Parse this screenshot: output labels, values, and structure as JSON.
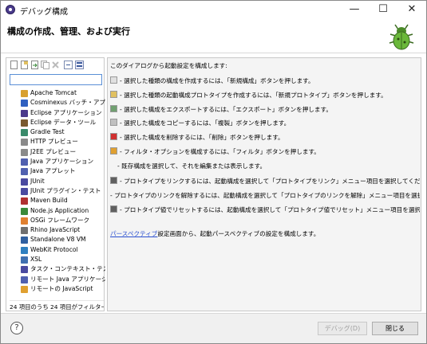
{
  "window": {
    "title": "デバッグ構成",
    "minimize_glyph": "—",
    "maximize_glyph": "☐",
    "close_glyph": "✕"
  },
  "header": {
    "title": "構成の作成、管理、および実行"
  },
  "left": {
    "filter_placeholder": "",
    "items": [
      {
        "label": "Apache Tomcat",
        "icon": "tomcat-icon",
        "color": "#d8a030"
      },
      {
        "label": "Cosminexus バッチ・アプリケ",
        "icon": "cosminexus-icon",
        "color": "#3060c0"
      },
      {
        "label": "Eclipse アプリケーション",
        "icon": "eclipse-icon",
        "color": "#4b3a8c"
      },
      {
        "label": "Eclipse データ・ツール",
        "icon": "datatools-icon",
        "color": "#7a5a30"
      },
      {
        "label": "Gradle Test",
        "icon": "gradle-icon",
        "color": "#3a8a6a"
      },
      {
        "label": "HTTP プレビュー",
        "icon": "http-icon",
        "color": "#8a8a8a"
      },
      {
        "label": "J2EE プレビュー",
        "icon": "j2ee-icon",
        "color": "#8a8a8a"
      },
      {
        "label": "Java アプリケーション",
        "icon": "java-app-icon",
        "color": "#5060b0"
      },
      {
        "label": "Java アプレット",
        "icon": "java-applet-icon",
        "color": "#5060b0"
      },
      {
        "label": "JUnit",
        "icon": "junit-icon",
        "color": "#4a4aa0"
      },
      {
        "label": "JUnit プラグイン・テスト",
        "icon": "junit-plugin-icon",
        "color": "#4a4aa0"
      },
      {
        "label": "Maven Build",
        "icon": "maven-icon",
        "color": "#b03030"
      },
      {
        "label": "Node.js Application",
        "icon": "nodejs-icon",
        "color": "#3a8a3a"
      },
      {
        "label": "OSGi フレームワーク",
        "icon": "osgi-icon",
        "color": "#e08030"
      },
      {
        "label": "Rhino JavaScript",
        "icon": "rhino-icon",
        "color": "#707070"
      },
      {
        "label": "Standalone V8 VM",
        "icon": "v8-icon",
        "color": "#3060a0"
      },
      {
        "label": "WebKit Protocol",
        "icon": "webkit-icon",
        "color": "#3080c0"
      },
      {
        "label": "XSL",
        "icon": "xsl-icon",
        "color": "#4070b0"
      },
      {
        "label": "タスク・コンテキスト・テスト",
        "icon": "task-test-icon",
        "color": "#4a4aa0"
      },
      {
        "label": "リモート Java アプリケーション",
        "icon": "remote-java-icon",
        "color": "#5060b0"
      },
      {
        "label": "リモートの JavaScript",
        "icon": "remote-js-icon",
        "color": "#e0a030"
      }
    ],
    "filter_status": "24 項目のうち 24 項目がフィルターに"
  },
  "right": {
    "intro": "このダイアログから起動設定を構成します:",
    "instructions": [
      {
        "text": "- 選択した種類の構成を作成するには、「新規構成」ボタンを押します。",
        "icon": "new-config-icon",
        "color": "#e0e0e0"
      },
      {
        "text": "- 選択した種類の起動構成プロトタイプを作成するには、「新規プロトタイプ」ボタンを押します。",
        "icon": "new-prototype-icon",
        "color": "#e0c060"
      },
      {
        "text": "- 選択した構成をエクスポートするには、「エクスポート」ボタンを押します。",
        "icon": "export-icon",
        "color": "#70a070"
      },
      {
        "text": "- 選択した構成をコピーするには、「複製」ボタンを押します。",
        "icon": "duplicate-icon",
        "color": "#c0c0c0"
      },
      {
        "text": "- 選択した構成を削除するには、「削除」ボタンを押します。",
        "icon": "delete-icon",
        "color": "#d03030"
      },
      {
        "text": "- フィルタ・オプションを構成するには、「フィルタ」ボタンを押します。",
        "icon": "filter-icon",
        "color": "#e0a030"
      },
      {
        "text": "- 既存構成を選択して、それを編集または表示します。",
        "icon": "",
        "color": ""
      },
      {
        "text": "- プロトタイプをリンクするには、起動構成を選択して「プロトタイプをリンク」メニュー項目を選択してください。",
        "icon": "link-prototype-icon",
        "color": "#606060"
      },
      {
        "text": "- プロトタイプのリンクを解除するには、起動構成を選択して「プロトタイプのリンクを解除」メニュー項目を選択してください。",
        "icon": "",
        "color": ""
      },
      {
        "text": "- プロトタイプ値でリセットするには、起動構成を選択して「プロトタイプ値でリセット」メニュー項目を選択してください。",
        "icon": "reset-prototype-icon",
        "color": "#606060"
      }
    ],
    "perspective_link": "パースペクティブ",
    "perspective_text": "設定画面から、起動パースペクティブの設定を構成します。"
  },
  "footer": {
    "help_glyph": "?",
    "debug_label": "デバッグ(D)",
    "close_label": "閉じる"
  }
}
